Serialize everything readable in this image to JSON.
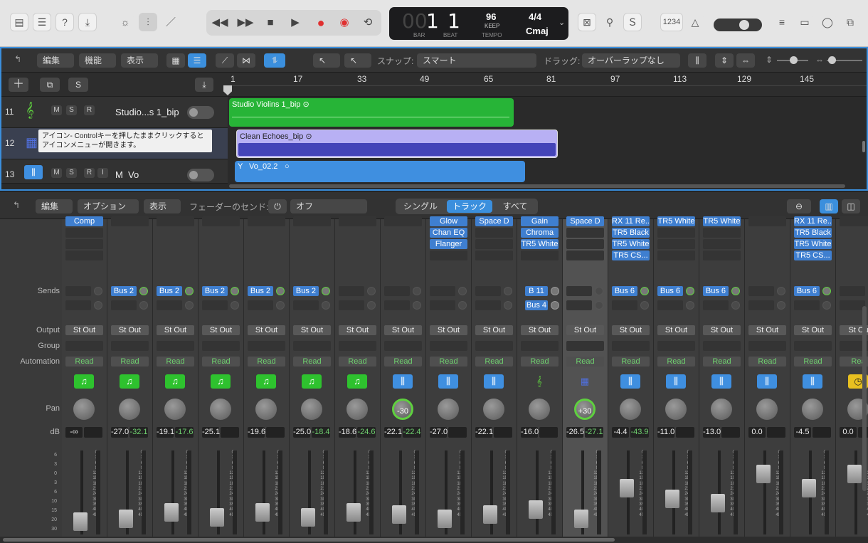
{
  "control_bar": {
    "lcd": {
      "bar": "1",
      "beat": "1",
      "bar_label": "BAR",
      "beat_label": "BEAT",
      "tempo": "96",
      "keep": "KEEP",
      "tempo_label": "TEMPO",
      "time_sig": "4/4",
      "key": "Cmaj",
      "bar_ghost": "00"
    },
    "count_in": "1234"
  },
  "tracks_toolbar": {
    "edit": "編集",
    "function": "機能",
    "view": "表示",
    "snap_label": "スナップ:",
    "snap_value": "スマート",
    "drag_label": "ドラッグ:",
    "drag_value": "オーバーラップなし"
  },
  "ruler": [
    "1",
    "17",
    "33",
    "49",
    "65",
    "81",
    "97",
    "113",
    "129",
    "145"
  ],
  "track_header_buttons": {
    "solo": "S"
  },
  "tracks": [
    {
      "num": "11",
      "name": "Studio...s 1_bip",
      "m": "M",
      "s": "S",
      "r": "R"
    },
    {
      "num": "12",
      "tooltip": "アイコン- Controlキーを押したままクリックするとアイコンメニューが開きます。"
    },
    {
      "num": "13",
      "name": "Vo",
      "m": "M",
      "s": "S",
      "r": "R",
      "i": "I",
      "m2": "M"
    }
  ],
  "regions": [
    {
      "name": "Studio Violins 1_bip"
    },
    {
      "name": "Clean Echoes_bip"
    },
    {
      "name": "Vo_02.2",
      "y": "Y"
    }
  ],
  "mixer_bar": {
    "edit": "編集",
    "options": "オプション",
    "view": "表示",
    "sends_label": "フェーダーのセンド:",
    "sends_value": "オフ",
    "single": "シングル",
    "tracks": "トラック",
    "all": "すべて"
  },
  "mixer_labels": {
    "sends": "Sends",
    "output": "Output",
    "group": "Group",
    "automation": "Automation",
    "pan": "Pan",
    "db": "dB"
  },
  "fader_scale": [
    "6",
    "3",
    "0",
    "3",
    "6",
    "10",
    "15",
    "20",
    "30"
  ],
  "meter_scale": [
    "0",
    "3",
    "6",
    "9",
    "12",
    "15",
    "18",
    "21",
    "24",
    "30",
    "35",
    "40",
    "45"
  ],
  "strips": [
    {
      "plugins": [
        "Comp"
      ],
      "sends": [],
      "output": "St Out",
      "auto": "Read",
      "icon": "note",
      "pan": "",
      "db1": "-∞",
      "db2": "",
      "fader": 0.05
    },
    {
      "plugins": [],
      "sends": [
        "Bus 2"
      ],
      "output": "St Out",
      "auto": "Read",
      "icon": "note",
      "pan": "",
      "db1": "-27.0",
      "db2": "-32.1",
      "fader": 0.1
    },
    {
      "plugins": [],
      "sends": [
        "Bus 2"
      ],
      "output": "St Out",
      "auto": "Read",
      "icon": "note",
      "pan": "",
      "db1": "-19.1",
      "db2": "-17.6",
      "fader": 0.2
    },
    {
      "plugins": [],
      "sends": [
        "Bus 2"
      ],
      "output": "St Out",
      "auto": "Read",
      "icon": "note",
      "pan": "",
      "db1": "-25.1",
      "db2": "",
      "fader": 0.12
    },
    {
      "plugins": [],
      "sends": [
        "Bus 2"
      ],
      "output": "St Out",
      "auto": "Read",
      "icon": "note",
      "pan": "",
      "db1": "-19.6",
      "db2": "",
      "fader": 0.2
    },
    {
      "plugins": [],
      "sends": [
        "Bus 2"
      ],
      "output": "St Out",
      "auto": "Read",
      "icon": "note",
      "pan": "",
      "db1": "-25.0",
      "db2": "-18.4",
      "fader": 0.12
    },
    {
      "plugins": [],
      "sends": [],
      "output": "St Out",
      "auto": "Read",
      "icon": "note",
      "pan": "",
      "db1": "-18.6",
      "db2": "-24.6",
      "fader": 0.2
    },
    {
      "plugins": [],
      "sends": [],
      "output": "St Out",
      "auto": "Read",
      "icon": "wave",
      "pan": "-30",
      "db1": "-22.1",
      "db2": "-22.4",
      "fader": 0.16
    },
    {
      "plugins": [
        "Glow",
        "Chan EQ",
        "Flanger"
      ],
      "sends": [],
      "output": "St Out",
      "auto": "Read",
      "icon": "wave",
      "pan": "",
      "db1": "-27.0",
      "db2": "",
      "fader": 0.1
    },
    {
      "plugins": [
        "Space D"
      ],
      "sends": [],
      "output": "St Out",
      "auto": "Read",
      "icon": "wave",
      "pan": "",
      "db1": "-22.1",
      "db2": "",
      "fader": 0.16
    },
    {
      "plugins": [
        "Gain",
        "Chroma",
        "TR5 White"
      ],
      "sends": [
        "B 11",
        "Bus 4"
      ],
      "output": "St Out",
      "auto": "Read",
      "icon": "violin",
      "pan": "",
      "db1": "-16.0",
      "db2": "",
      "fader": 0.24
    },
    {
      "plugins": [
        "Space D"
      ],
      "sends": [],
      "output": "St Out",
      "auto": "Read",
      "icon": "drum",
      "pan": "+30",
      "db1": "-26.5",
      "db2": "-27.1",
      "fader": 0.1,
      "selected": true
    },
    {
      "plugins": [
        "RX 11 Re...",
        "TR5 Black",
        "TR5 White",
        "TR5 CS..."
      ],
      "sends": [
        "Bus 6"
      ],
      "output": "St Out",
      "auto": "Read",
      "icon": "wave",
      "pan": "",
      "db1": "-4.4",
      "db2": "-43.9",
      "fader": 0.56
    },
    {
      "plugins": [
        "TR5 White"
      ],
      "sends": [
        "Bus 6"
      ],
      "output": "St Out",
      "auto": "Read",
      "icon": "wave",
      "pan": "",
      "db1": "-11.0",
      "db2": "",
      "fader": 0.4
    },
    {
      "plugins": [
        "TR5 White"
      ],
      "sends": [
        "Bus 6"
      ],
      "output": "St Out",
      "auto": "Read",
      "icon": "wave",
      "pan": "",
      "db1": "-13.0",
      "db2": "",
      "fader": 0.34
    },
    {
      "plugins": [],
      "sends": [],
      "output": "St Out",
      "auto": "Read",
      "icon": "wave",
      "pan": "",
      "db1": "0.0",
      "db2": "",
      "fader": 0.78
    },
    {
      "plugins": [
        "RX 11 Re...",
        "TR5 Black",
        "TR5 White",
        "TR5 CS..."
      ],
      "sends": [
        "Bus 6"
      ],
      "output": "St Out",
      "auto": "Read",
      "icon": "wave",
      "pan": "",
      "db1": "-4.5",
      "db2": "",
      "fader": 0.56
    },
    {
      "plugins": [],
      "sends": [],
      "output": "St Ou",
      "auto": "Rea",
      "icon": "clock",
      "pan": "",
      "db1": "0.0",
      "db2": "",
      "fader": 0.78
    }
  ]
}
